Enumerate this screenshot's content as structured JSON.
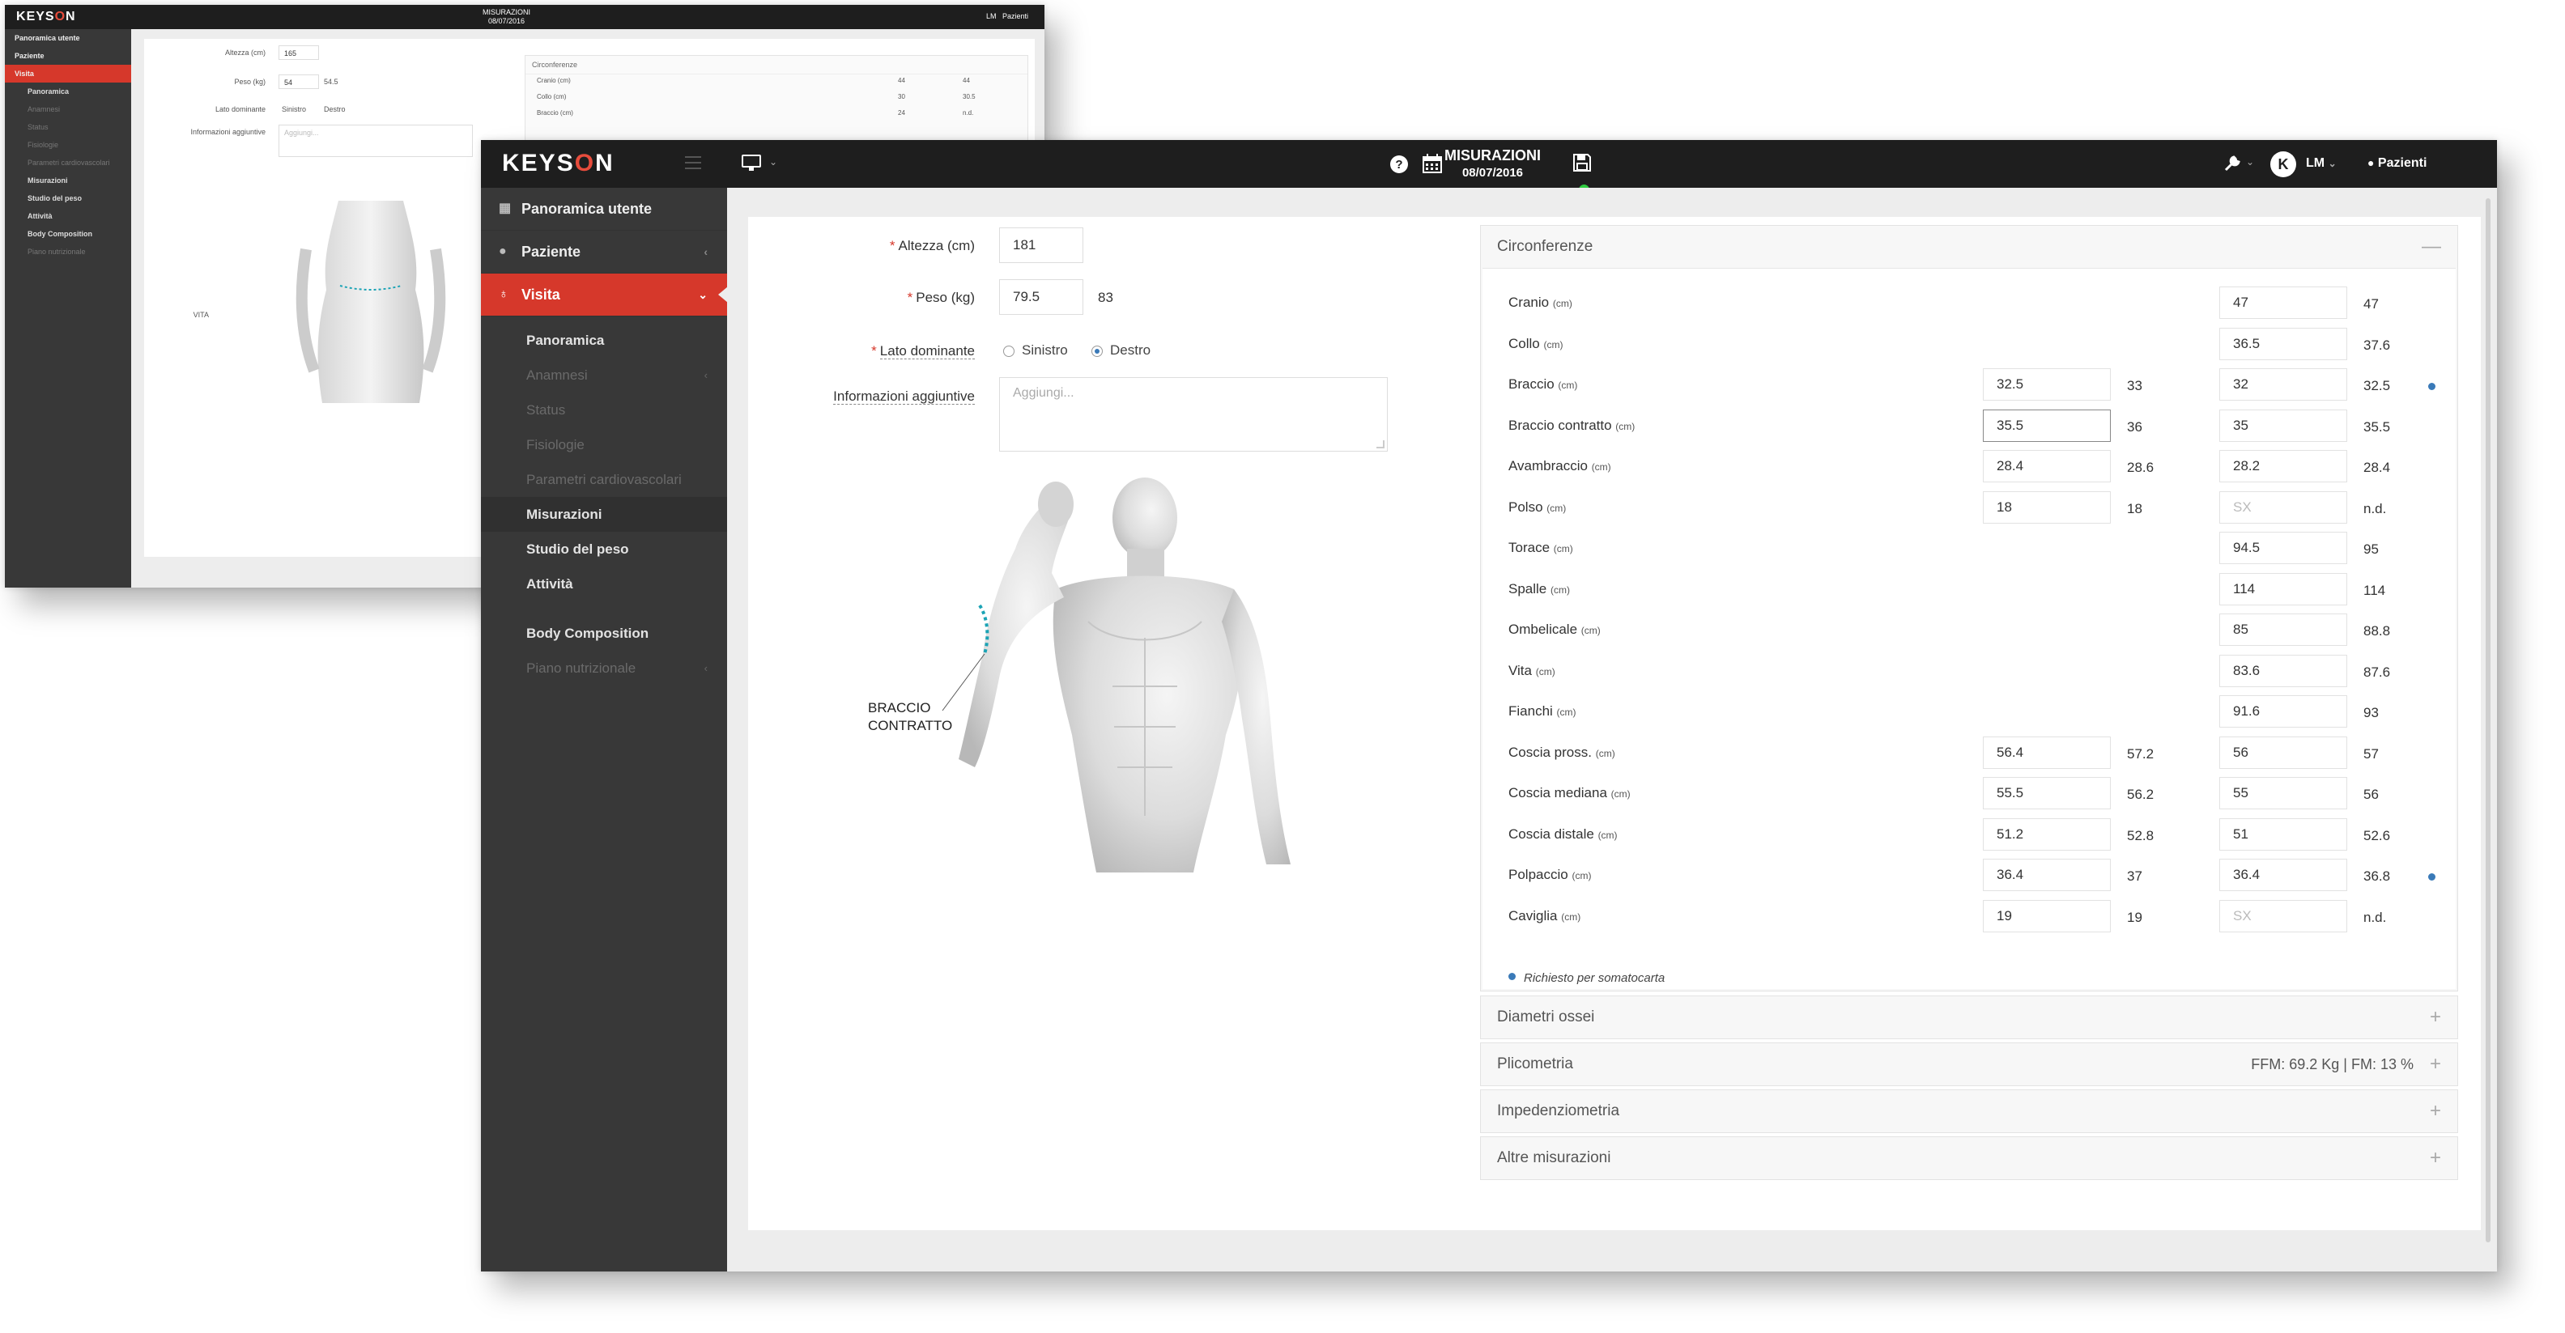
{
  "brand": {
    "logo_pre": "K",
    "logo_mid": "EYS",
    "logo_o": "O",
    "logo_post": "N"
  },
  "topbar": {
    "title": "MISURAZIONI",
    "date": "08/07/2016",
    "user_initials": "LM",
    "patients_label": "Pazienti",
    "help_icon": "question-circle-icon",
    "calendar_icon": "calendar-icon",
    "save_icon": "save-icon",
    "tools_icon": "wrench-icon"
  },
  "back_topbar": {
    "title": "MISURAZIONI",
    "date": "08/07/2016",
    "user": "LM",
    "patients": "Pazienti"
  },
  "sidebar": {
    "items": [
      {
        "label": "Panoramica utente",
        "icon": "dashboard-icon"
      },
      {
        "label": "Paziente",
        "icon": "user-icon"
      },
      {
        "label": "Visita",
        "icon": "stethoscope-icon"
      }
    ],
    "sub_items": [
      {
        "label": "Panoramica"
      },
      {
        "label": "Anamnesi"
      },
      {
        "label": "Status"
      },
      {
        "label": "Fisiologie"
      },
      {
        "label": "Parametri cardiovascolari"
      },
      {
        "label": "Misurazioni"
      },
      {
        "label": "Studio del peso"
      },
      {
        "label": "Attività"
      },
      {
        "label": "Body Composition"
      },
      {
        "label": "Piano nutrizionale"
      }
    ]
  },
  "form": {
    "height_label": "Altezza (cm)",
    "height_value": "181",
    "weight_label": "Peso (kg)",
    "weight_value": "79.5",
    "weight_prev": "83",
    "side_label": "Lato dominante",
    "side_left": "Sinistro",
    "side_right": "Destro",
    "side_selected": "Destro",
    "notes_label": "Informazioni aggiuntive",
    "notes_placeholder": "Aggiungi..."
  },
  "figure": {
    "label_line1": "BRACCIO",
    "label_line2": "CONTRATTO"
  },
  "back_form": {
    "height_label": "Altezza (cm)",
    "height_value": "165",
    "weight_label": "Peso (kg)",
    "weight_value": "54",
    "weight_prev": "54.5",
    "side_label": "Lato dominante",
    "side_left": "Sinistro",
    "side_right": "Destro",
    "notes_label": "Informazioni aggiuntive",
    "notes_placeholder": "Aggiungi...",
    "figure_label": "VITA",
    "circ_title": "Circonferenze",
    "rows": [
      {
        "label": "Cranio (cm)",
        "v": "44",
        "p": "44"
      },
      {
        "label": "Collo (cm)",
        "v": "30",
        "p": "30.5"
      },
      {
        "label": "Braccio (cm)",
        "v": "24",
        "p": "n.d."
      }
    ]
  },
  "circonferenze": {
    "title": "Circonferenze",
    "legend": "Richiesto per somatocarta",
    "rows": [
      {
        "label": "Cranio",
        "unit": "(cm)",
        "left": null,
        "left_prev": null,
        "right": "47",
        "right_prev": "47",
        "required": false
      },
      {
        "label": "Collo",
        "unit": "(cm)",
        "left": null,
        "left_prev": null,
        "right": "36.5",
        "right_prev": "37.6",
        "required": false
      },
      {
        "label": "Braccio",
        "unit": "(cm)",
        "left": "32.5",
        "left_prev": "33",
        "right": "32",
        "right_prev": "32.5",
        "required": true
      },
      {
        "label": "Braccio contratto",
        "unit": "(cm)",
        "left": "35.5",
        "left_prev": "36",
        "right": "35",
        "right_prev": "35.5",
        "required": false
      },
      {
        "label": "Avambraccio",
        "unit": "(cm)",
        "left": "28.4",
        "left_prev": "28.6",
        "right": "28.2",
        "right_prev": "28.4",
        "required": false
      },
      {
        "label": "Polso",
        "unit": "(cm)",
        "left": "18",
        "left_prev": "18",
        "right": "SX",
        "right_prev": "n.d.",
        "required": false
      },
      {
        "label": "Torace",
        "unit": "(cm)",
        "left": null,
        "left_prev": null,
        "right": "94.5",
        "right_prev": "95",
        "required": false
      },
      {
        "label": "Spalle",
        "unit": "(cm)",
        "left": null,
        "left_prev": null,
        "right": "114",
        "right_prev": "114",
        "required": false
      },
      {
        "label": "Ombelicale",
        "unit": "(cm)",
        "left": null,
        "left_prev": null,
        "right": "85",
        "right_prev": "88.8",
        "required": false
      },
      {
        "label": "Vita",
        "unit": "(cm)",
        "left": null,
        "left_prev": null,
        "right": "83.6",
        "right_prev": "87.6",
        "required": false
      },
      {
        "label": "Fianchi",
        "unit": "(cm)",
        "left": null,
        "left_prev": null,
        "right": "91.6",
        "right_prev": "93",
        "required": false
      },
      {
        "label": "Coscia pross.",
        "unit": "(cm)",
        "left": "56.4",
        "left_prev": "57.2",
        "right": "56",
        "right_prev": "57",
        "required": false
      },
      {
        "label": "Coscia mediana",
        "unit": "(cm)",
        "left": "55.5",
        "left_prev": "56.2",
        "right": "55",
        "right_prev": "56",
        "required": false
      },
      {
        "label": "Coscia distale",
        "unit": "(cm)",
        "left": "51.2",
        "left_prev": "52.8",
        "right": "51",
        "right_prev": "52.6",
        "required": false
      },
      {
        "label": "Polpaccio",
        "unit": "(cm)",
        "left": "36.4",
        "left_prev": "37",
        "right": "36.4",
        "right_prev": "36.8",
        "required": true
      },
      {
        "label": "Caviglia",
        "unit": "(cm)",
        "left": "19",
        "left_prev": "19",
        "right": "SX",
        "right_prev": "n.d.",
        "required": false
      }
    ]
  },
  "sections": [
    {
      "title": "Diametri ossei",
      "extra": ""
    },
    {
      "title": "Plicometria",
      "extra": "FFM: 69.2 Kg | FM: 13 %"
    },
    {
      "title": "Impedenziometria",
      "extra": ""
    },
    {
      "title": "Altre misurazioni",
      "extra": ""
    }
  ],
  "colors": {
    "accent_red": "#d6382b",
    "topbar": "#1e1e1e",
    "sidebar": "#383838",
    "required_dot": "#3a7ab8",
    "status_green": "#2ecc40"
  }
}
